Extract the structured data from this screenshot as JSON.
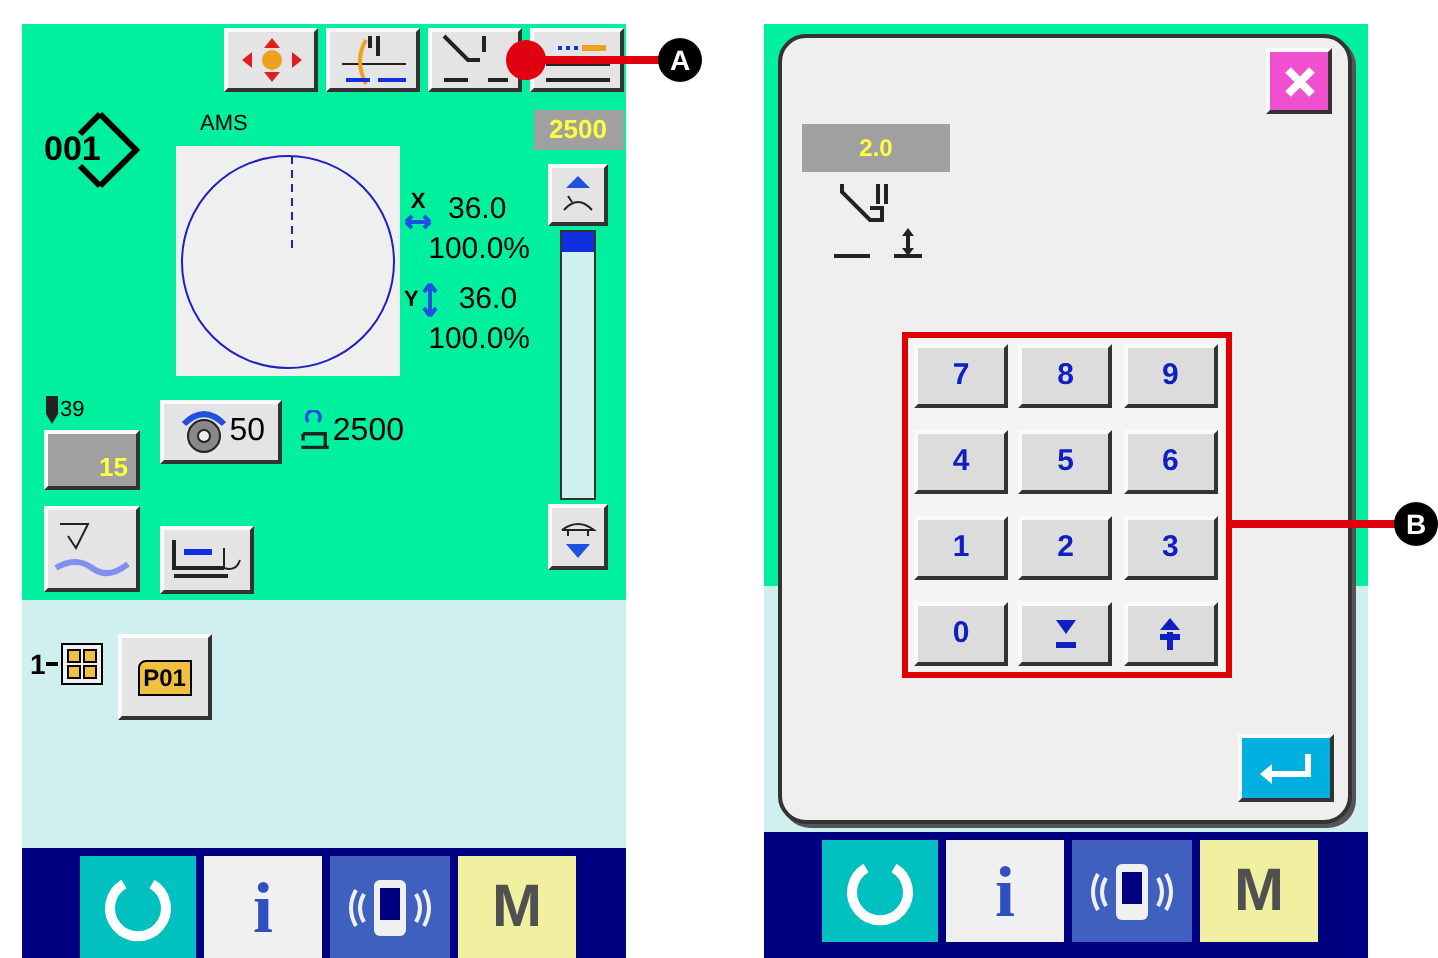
{
  "left_screen": {
    "pattern_number": "001",
    "pattern_name": "AMS",
    "max_speed": "2500",
    "x_scale": {
      "axis": "X",
      "size": "36.0",
      "percent": "100.0%"
    },
    "y_scale": {
      "axis": "Y",
      "size": "36.0",
      "percent": "100.0%"
    },
    "speed_slider": {
      "level": 1.0
    },
    "needle_thread": "39",
    "tension": "15",
    "counter_value": "50",
    "production_count": "2500",
    "folder_number": "1",
    "folder_name": "P01",
    "callout": {
      "label": "A"
    },
    "bottom_bar": [
      {
        "kind": "ready"
      },
      {
        "kind": "info",
        "label": "i"
      },
      {
        "kind": "comm"
      },
      {
        "kind": "mode",
        "label": "M"
      }
    ]
  },
  "right_screen": {
    "value": "2.0",
    "keypad": [
      {
        "kind": "digit",
        "label": "7"
      },
      {
        "kind": "digit",
        "label": "8"
      },
      {
        "kind": "digit",
        "label": "9"
      },
      {
        "kind": "digit",
        "label": "4"
      },
      {
        "kind": "digit",
        "label": "5"
      },
      {
        "kind": "digit",
        "label": "6"
      },
      {
        "kind": "digit",
        "label": "1"
      },
      {
        "kind": "digit",
        "label": "2"
      },
      {
        "kind": "digit",
        "label": "3"
      },
      {
        "kind": "digit",
        "label": "0"
      },
      {
        "kind": "minus"
      },
      {
        "kind": "plus"
      }
    ],
    "callout": {
      "label": "B"
    },
    "bottom_bar": [
      {
        "kind": "ready"
      },
      {
        "kind": "info",
        "label": "i"
      },
      {
        "kind": "comm"
      },
      {
        "kind": "mode",
        "label": "M"
      }
    ]
  }
}
